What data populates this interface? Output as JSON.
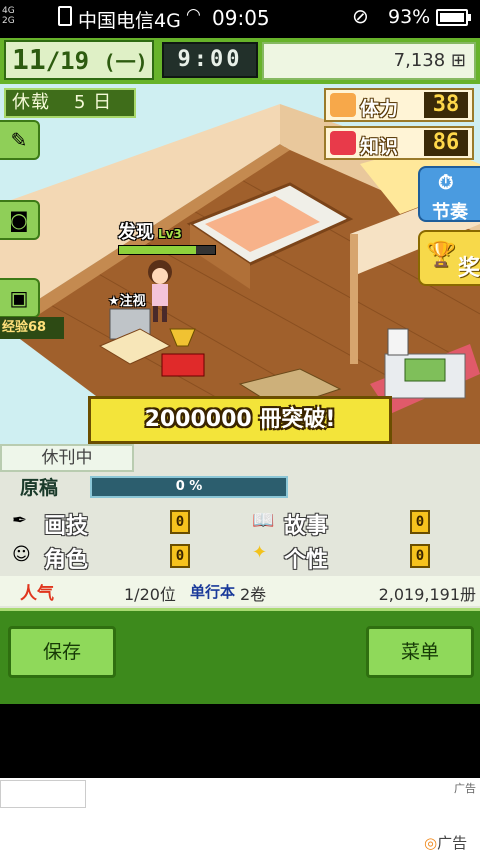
{
  "status_bar": {
    "network": "4G|\n2G|",
    "carrier": "中国电信4G",
    "time": "09:05",
    "battery": "93%"
  },
  "hud": {
    "date_month": "11",
    "date_day": "/19",
    "date_weekday": "(一)",
    "clock": "9:00",
    "money": "7,138 ⊞"
  },
  "scene": {
    "rest_label": "休载",
    "rest_days": "5 日",
    "stamina_label": "体力",
    "stamina_value": "38",
    "knowledge_label": "知识",
    "knowledge_value": "86",
    "rhythm_label": "节奏",
    "award_label": "奖",
    "exp_label": "经验68",
    "notice_text": "发现",
    "notice_level": "Lv3",
    "notice_progress": 0.8,
    "attention_text": "注视",
    "banner_text": "2000000 冊突破!"
  },
  "panel": {
    "pause_label": "休刊中",
    "draft_label": "原稿",
    "draft_percent": "0 %",
    "draft_progress": 0,
    "skills": {
      "drawing_label": "画技",
      "drawing_value": "0",
      "story_label": "故事",
      "story_value": "0",
      "character_label": "角色",
      "character_value": "0",
      "personality_label": "个性",
      "personality_value": "0"
    },
    "popularity_label": "人气",
    "rank": "1/20位",
    "single_label": "单行本",
    "volumes": "2卷",
    "sold": "2,019,191册"
  },
  "buttons": {
    "save_label": "保存",
    "menu_label": "菜单"
  },
  "ad": {
    "small_tag": "广告",
    "bottom_tag": "广告"
  },
  "colors": {
    "hud_green": "#67b32a",
    "wood_floor": "#9c5a2a",
    "banner_yellow": "#f3e43a",
    "button_green": "#8fd95a"
  }
}
